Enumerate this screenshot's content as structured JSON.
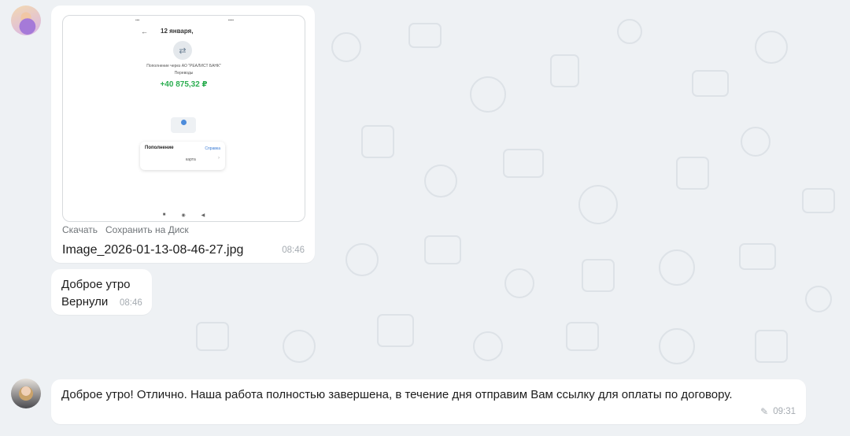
{
  "messages": {
    "photo": {
      "file_actions": [
        "Скачать",
        "Сохранить на Диск"
      ],
      "file_name": "Image_2026-01-13-08-46-27.jpg",
      "time": "08:46",
      "screenshot": {
        "date": "12 января,",
        "operation": "Пополнение через АО \"РЕАЛИСТ БАНК\"",
        "category": "Переводы",
        "amount": "+40 875,32 ₽",
        "card_title": "Пополнение",
        "card_link": "Справка",
        "card_value": "карта"
      }
    },
    "text": {
      "line1": "Доброе утро",
      "line2": "Вернули",
      "time": "08:46"
    },
    "reply": {
      "text": "Доброе утро! Отлично. Наша работа полностью завершена, в течение дня отправим Вам ссылку для оплаты по договору.",
      "time": "09:31"
    }
  }
}
